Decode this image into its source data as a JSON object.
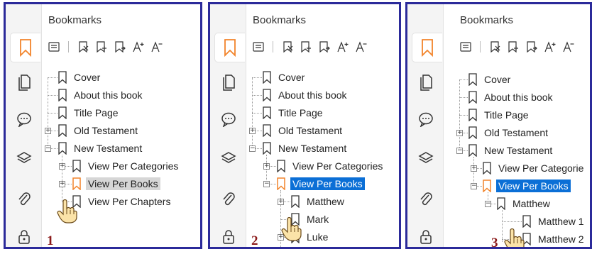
{
  "panel_title": "Bookmarks",
  "colors": {
    "accent": "#f2842b",
    "selection": "#0b6fd6",
    "frame": "#2b2a9a",
    "step_number": "#8b1a1a"
  },
  "sidebar_icons": [
    "bookmark-icon",
    "pages-icon",
    "comments-icon",
    "layers-icon",
    "attachments-icon",
    "security-lock-icon"
  ],
  "toolbar_icons": [
    "bookmark-options-icon",
    "delete-bookmark-icon",
    "add-bookmark-icon",
    "add-child-bookmark-icon",
    "increase-font-icon",
    "decrease-font-icon"
  ],
  "panels": [
    {
      "step": "1",
      "nodes": [
        {
          "label": "Cover"
        },
        {
          "label": "About this book"
        },
        {
          "label": "Title Page"
        },
        {
          "label": "Old Testament"
        },
        {
          "label": "New Testament"
        },
        {
          "label": "View Per Categories"
        },
        {
          "label": "View Per Books"
        },
        {
          "label": "View Per Chapters"
        }
      ]
    },
    {
      "step": "2",
      "nodes": [
        {
          "label": "Cover"
        },
        {
          "label": "About this book"
        },
        {
          "label": "Title Page"
        },
        {
          "label": "Old Testament"
        },
        {
          "label": "New Testament"
        },
        {
          "label": "View Per Categories"
        },
        {
          "label": "View Per Books"
        },
        {
          "label": "Matthew"
        },
        {
          "label": "Mark"
        },
        {
          "label": "Luke"
        }
      ]
    },
    {
      "step": "3",
      "nodes": [
        {
          "label": "Cover"
        },
        {
          "label": "About this book"
        },
        {
          "label": "Title Page"
        },
        {
          "label": "Old Testament"
        },
        {
          "label": "New Testament"
        },
        {
          "label": "View Per Categorie"
        },
        {
          "label": "View Per Books"
        },
        {
          "label": "Matthew"
        },
        {
          "label": "Matthew 1"
        },
        {
          "label": "Matthew 2"
        }
      ]
    }
  ]
}
